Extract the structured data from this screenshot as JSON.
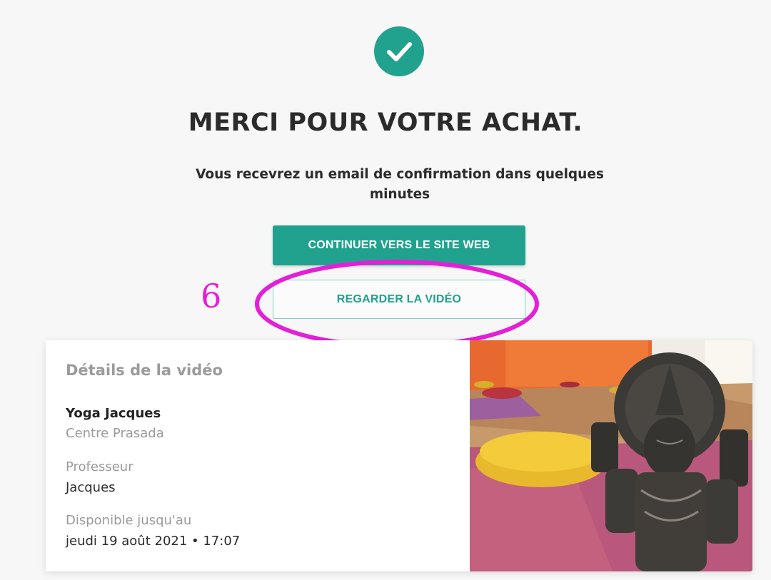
{
  "confirmation": {
    "icon": "check-circle-icon",
    "title": "MERCI POUR VOTRE ACHAT.",
    "message": "Vous recevrez un email de confirmation dans quelques minutes"
  },
  "actions": {
    "continue_label": "CONTINUER VERS LE SITE WEB",
    "watch_label": "REGARDER LA VIDÉO"
  },
  "annotation": {
    "number": "6"
  },
  "video_details": {
    "heading": "Détails de la vidéo",
    "name": "Yoga Jacques",
    "center": "Centre Prasada",
    "teacher_label": "Professeur",
    "teacher": "Jacques",
    "available_label": "Disponible jusqu'au",
    "available_until": "jeudi 19 août 2021 • 17:07"
  },
  "colors": {
    "accent": "#21a28f",
    "annotation": "#e41fd8",
    "background": "#f7f7f7"
  }
}
